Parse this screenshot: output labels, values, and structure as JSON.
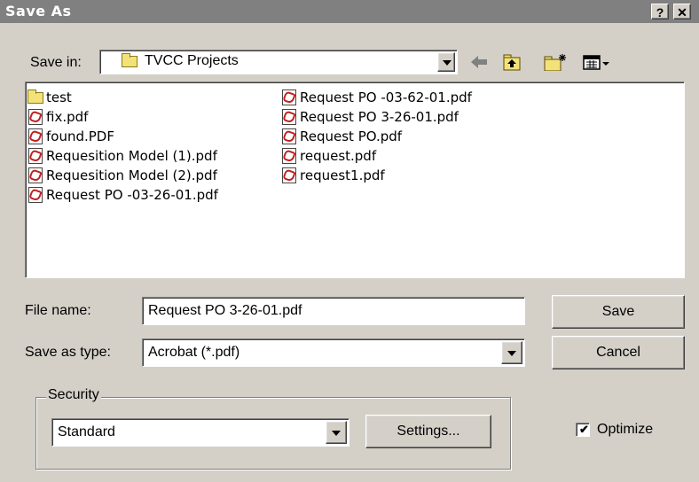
{
  "window": {
    "title": "Save As",
    "help_label": "?",
    "close_label": "✕"
  },
  "toolbar": {
    "save_in_label": "Save in:",
    "location": "TVCC Projects",
    "icons": [
      "back-arrow-icon",
      "up-folder-icon",
      "new-folder-icon",
      "view-menu-icon"
    ]
  },
  "files": {
    "column1": [
      {
        "name": "test",
        "type": "folder"
      },
      {
        "name": "fix.pdf",
        "type": "pdf"
      },
      {
        "name": "found.PDF",
        "type": "pdf"
      },
      {
        "name": "Requesition Model (1).pdf",
        "type": "pdf"
      },
      {
        "name": "Requesition Model (2).pdf",
        "type": "pdf"
      },
      {
        "name": "Request PO -03-26-01.pdf",
        "type": "pdf"
      }
    ],
    "column2": [
      {
        "name": "Request PO -03-62-01.pdf",
        "type": "pdf"
      },
      {
        "name": "Request PO 3-26-01.pdf",
        "type": "pdf"
      },
      {
        "name": "Request PO.pdf",
        "type": "pdf"
      },
      {
        "name": "request.pdf",
        "type": "pdf"
      },
      {
        "name": "request1.pdf",
        "type": "pdf"
      }
    ]
  },
  "form": {
    "file_name_label": "File name:",
    "file_name_value": "Request PO 3-26-01.pdf",
    "save_as_type_label": "Save as type:",
    "save_as_type_value": "Acrobat (*.pdf)",
    "save_button": "Save",
    "cancel_button": "Cancel"
  },
  "security": {
    "group_label": "Security",
    "value": "Standard",
    "settings_button": "Settings..."
  },
  "optimize": {
    "label": "Optimize",
    "checked": true,
    "check_mark": "✔"
  }
}
